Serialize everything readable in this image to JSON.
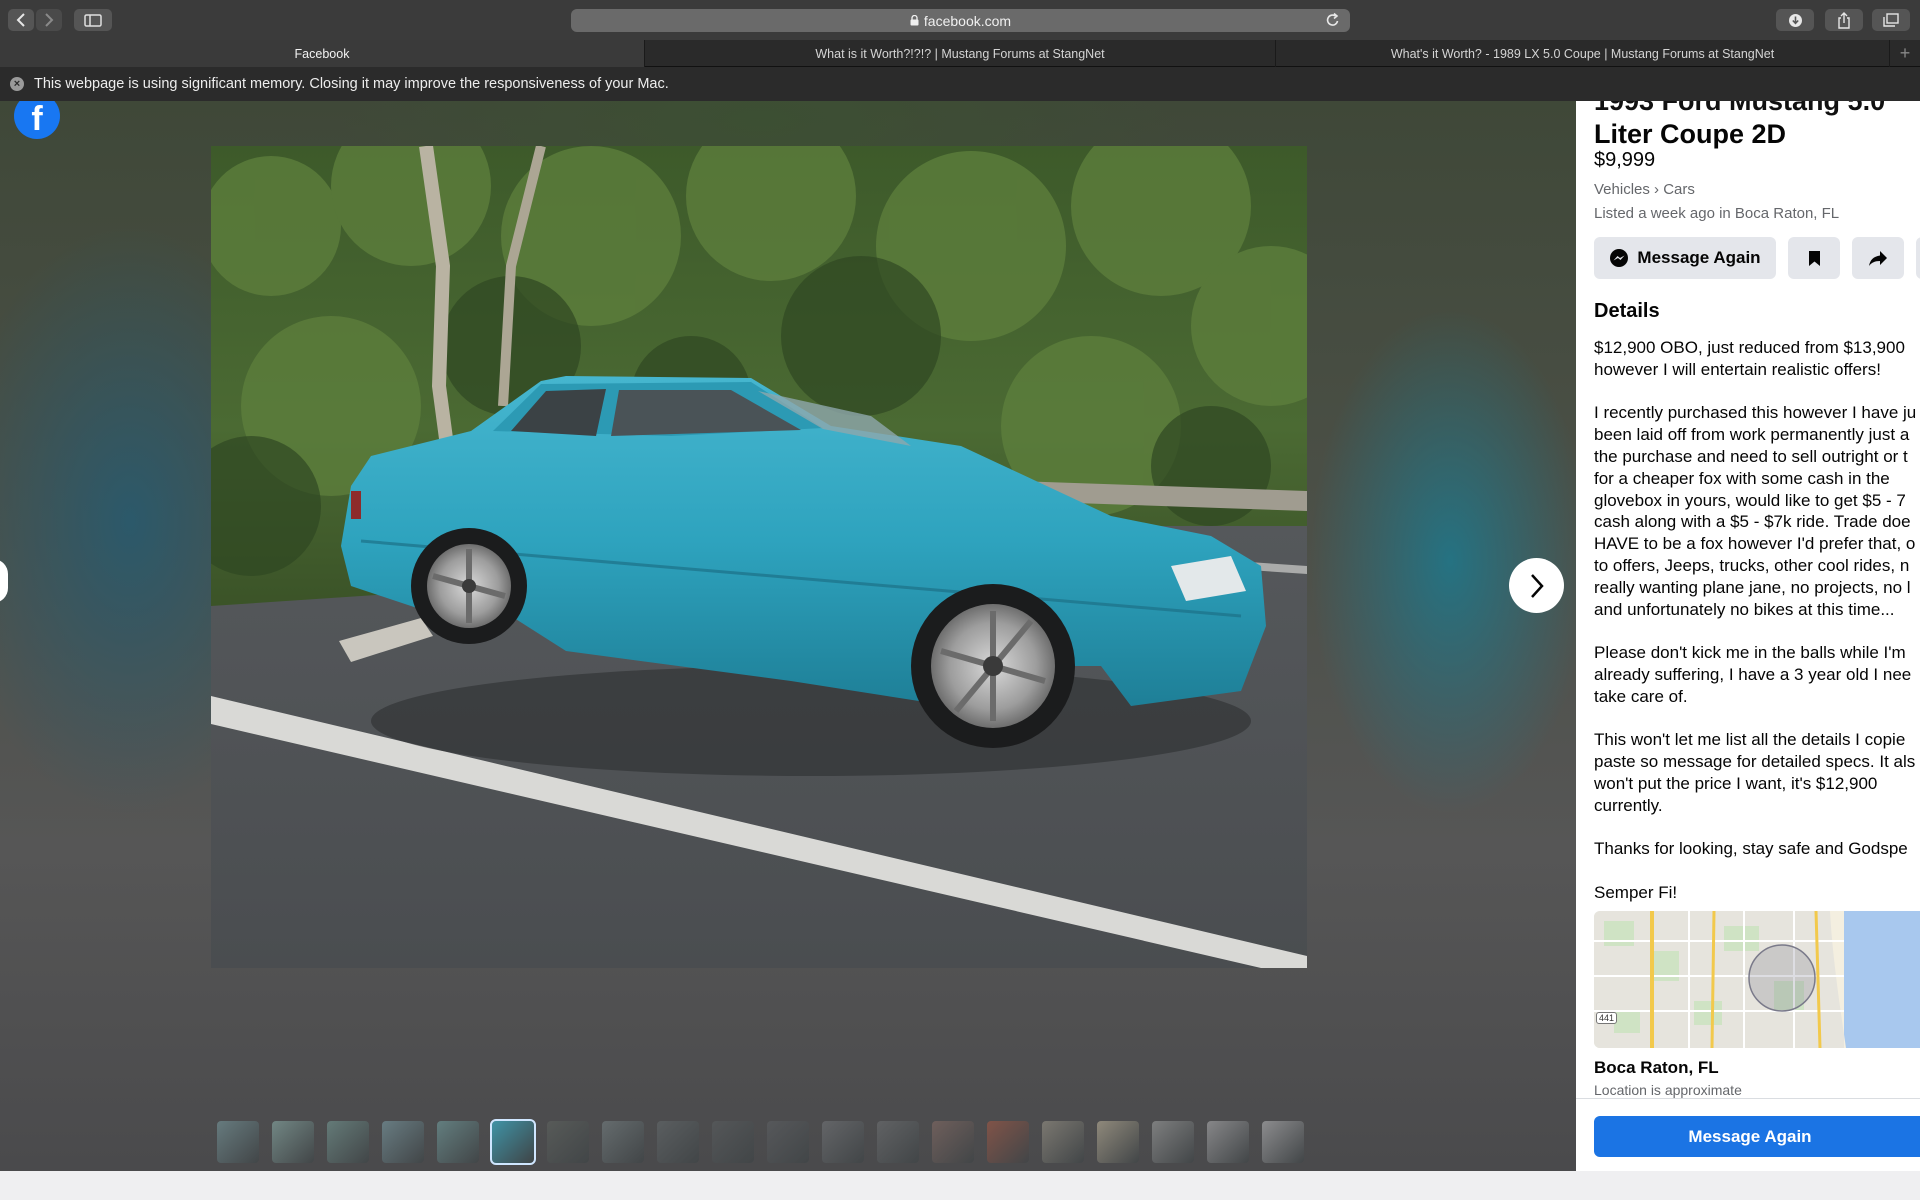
{
  "browser": {
    "url": "facebook.com",
    "tabs": [
      {
        "label": "Facebook",
        "active": true
      },
      {
        "label": "What is it Worth?!?!? | Mustang Forums at StangNet",
        "active": false
      },
      {
        "label": "What's it Worth? - 1989 LX 5.0 Coupe | Mustang Forums at StangNet",
        "active": false
      }
    ],
    "add_tab": "+",
    "notice": "This webpage is using significant memory. Closing it may improve the responsiveness of your Mac."
  },
  "viewer": {
    "logo": "f",
    "thumbnail_count": 20,
    "active_thumbnail": 6,
    "thumbnail_colors": [
      "#6f8a8e",
      "#7e9a96",
      "#6c8a86",
      "#718c93",
      "#6a8e8f",
      "#3f93a6",
      "#5b5f5c",
      "#6d7678",
      "#5f6466",
      "#575a5c",
      "#5a5c5f",
      "#6b6d70",
      "#67696b",
      "#7a6560",
      "#925646",
      "#8a867c",
      "#a59d8a",
      "#8e8f8f",
      "#9a9a9c",
      "#a1a1a3"
    ]
  },
  "listing": {
    "title_line1": "1993 Ford Mustang 5.0",
    "title_line2": "Liter Coupe 2D",
    "price": "$9,999",
    "breadcrumb": "Vehicles › Cars",
    "listed": "Listed a week ago in Boca Raton, FL",
    "message_button": "Message Again",
    "details_heading": "Details",
    "description": [
      {
        "text": "$12,900 OBO, just reduced from $13,900",
        "gap": false
      },
      {
        "text": "however I will entertain realistic offers!",
        "gap": false
      },
      {
        "text": "I recently purchased this however I have ju",
        "gap": true
      },
      {
        "text": "been laid off from work permanently just a",
        "gap": false
      },
      {
        "text": "the purchase and need to sell outright or t",
        "gap": false
      },
      {
        "text": "for a cheaper fox with some cash in the",
        "gap": false
      },
      {
        "text": "glovebox in yours, would like to get $5 - 7",
        "gap": false
      },
      {
        "text": "cash along with a $5 - $7k ride. Trade doe",
        "gap": false
      },
      {
        "text": "HAVE to be a fox however I'd prefer that, o",
        "gap": false
      },
      {
        "text": "to offers, Jeeps, trucks, other cool rides, n",
        "gap": false
      },
      {
        "text": "really wanting plane jane, no projects, no l",
        "gap": false
      },
      {
        "text": "and unfortunately no bikes at this time...",
        "gap": false
      },
      {
        "text": "Please don't kick me in the balls while I'm",
        "gap": true
      },
      {
        "text": "already suffering, I have a 3 year old I nee",
        "gap": false
      },
      {
        "text": "take care of.",
        "gap": false
      },
      {
        "text": "This won't let me list all the details I copie",
        "gap": true
      },
      {
        "text": "paste so message for detailed specs. It als",
        "gap": false
      },
      {
        "text": "won't put the price I want, it's $12,900",
        "gap": false
      },
      {
        "text": "currently.",
        "gap": false
      },
      {
        "text": "Thanks for looking, stay safe and Godspe",
        "gap": true
      },
      {
        "text": "Semper Fi!",
        "gap": true
      }
    ],
    "map_road_label": "441",
    "location": "Boca Raton, FL",
    "location_note": "Location is approximate",
    "bottom_button": "Message Again"
  }
}
